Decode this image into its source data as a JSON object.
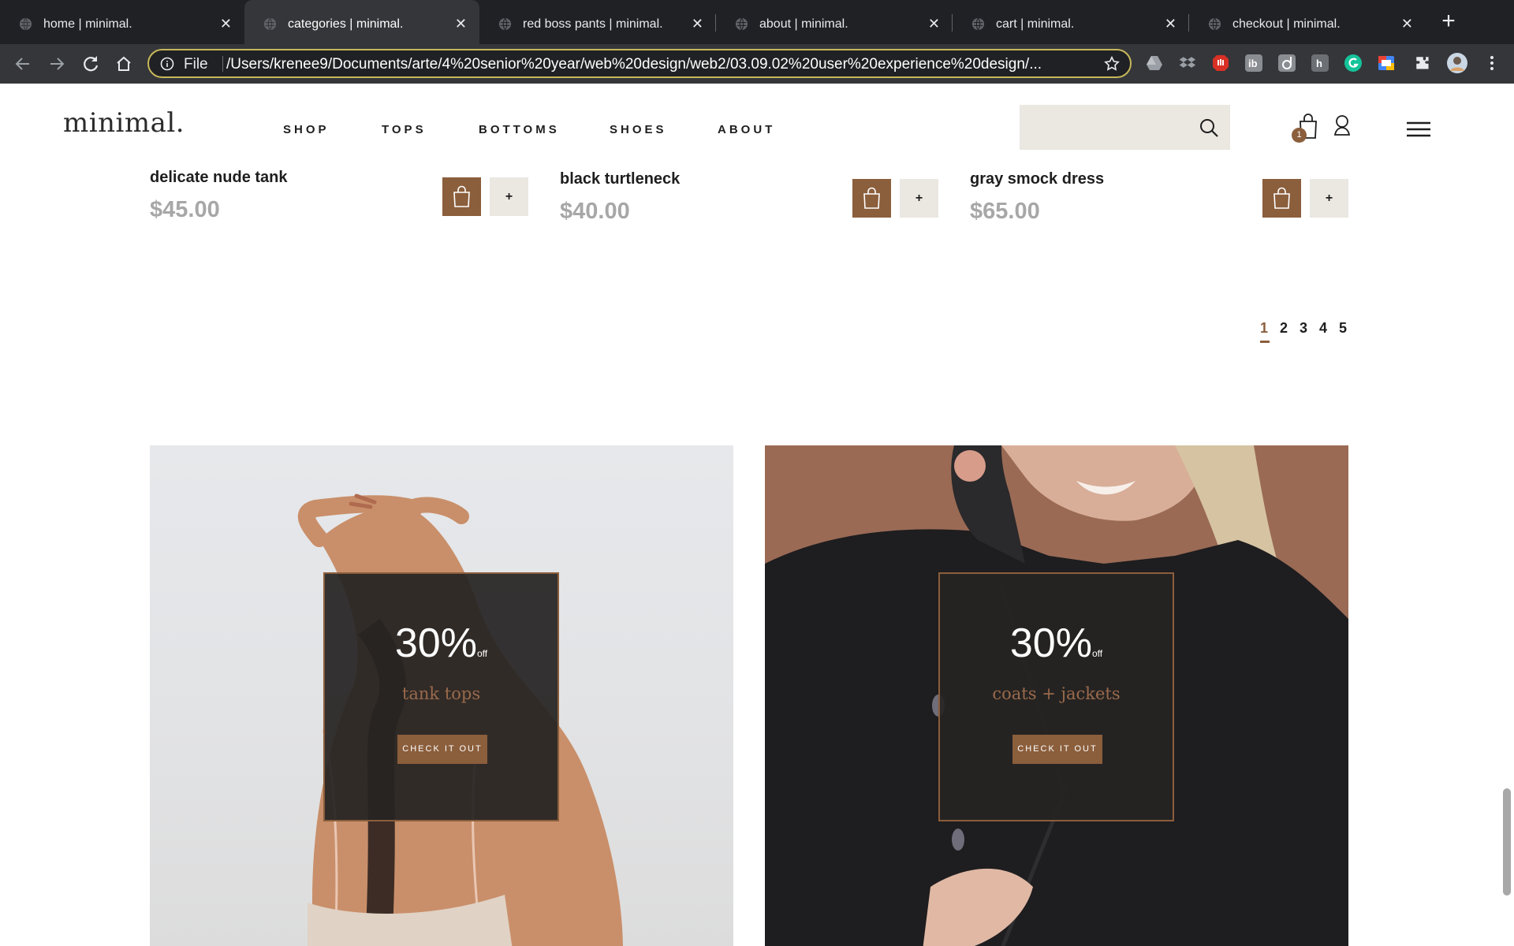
{
  "browser": {
    "tabs": [
      {
        "title": "home | minimal.",
        "active": false
      },
      {
        "title": "categories | minimal.",
        "active": true
      },
      {
        "title": "red boss pants | minimal.",
        "active": false
      },
      {
        "title": "about | minimal.",
        "active": false
      },
      {
        "title": "cart | minimal.",
        "active": false
      },
      {
        "title": "checkout | minimal.",
        "active": false
      }
    ],
    "omnibox": {
      "scheme_label": "File",
      "url": "/Users/krenee9/Documents/arte/4%20senior%20year/web%20design/web2/03.09.02%20user%20experience%20design/..."
    },
    "close_glyph": "✕",
    "newtab_glyph": "+"
  },
  "site": {
    "logo": "minimal.",
    "nav": [
      "SHOP",
      "TOPS",
      "BOTTOMS",
      "SHOES",
      "ABOUT"
    ],
    "cart_count": "1",
    "brand_color": "#8b5e3c",
    "search_bg": "#ebe7e1"
  },
  "products": [
    {
      "name": "delicate nude tank",
      "price": "$45.00",
      "add_label": "+"
    },
    {
      "name": "black turtleneck",
      "price": "$40.00",
      "add_label": "+"
    },
    {
      "name": "gray smock dress",
      "price": "$65.00",
      "add_label": "+"
    }
  ],
  "pagination": {
    "pages": [
      "1",
      "2",
      "3",
      "4",
      "5"
    ],
    "current": "1"
  },
  "promos": [
    {
      "percent": "30%",
      "off": "off",
      "label": "tank tops",
      "cta": "CHECK IT OUT"
    },
    {
      "percent": "30%",
      "off": "off",
      "label": "coats + jackets",
      "cta": "CHECK IT OUT"
    }
  ]
}
